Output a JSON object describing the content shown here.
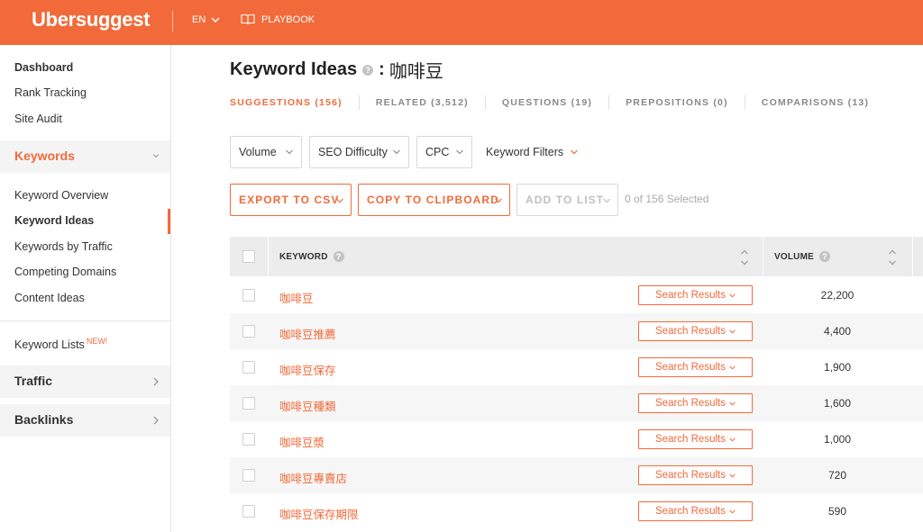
{
  "topbar": {
    "logo": "Ubersuggest",
    "language": "EN",
    "playbook": "PLAYBOOK"
  },
  "sidebar": {
    "top_links": [
      "Dashboard",
      "Rank Tracking",
      "Site Audit"
    ],
    "keywords_section": "Keywords",
    "keywords_items": [
      "Keyword Overview",
      "Keyword Ideas",
      "Keywords by Traffic",
      "Competing Domains",
      "Content Ideas"
    ],
    "keyword_lists": "Keyword Lists",
    "new_badge": "NEW!",
    "traffic_section": "Traffic",
    "backlinks_section": "Backlinks"
  },
  "main": {
    "title": "Keyword Ideas",
    "title_separator": ":",
    "keyword": "咖啡豆",
    "tabs": [
      {
        "label": "SUGGESTIONS (156)",
        "active": true
      },
      {
        "label": "RELATED (3,512)",
        "active": false
      },
      {
        "label": "QUESTIONS (19)",
        "active": false
      },
      {
        "label": "PREPOSITIONS (0)",
        "active": false
      },
      {
        "label": "COMPARISONS (13)",
        "active": false
      }
    ],
    "filters": {
      "volume": "Volume",
      "seo_difficulty": "SEO Difficulty",
      "cpc": "CPC",
      "keyword_filters": "Keyword Filters"
    },
    "actions": {
      "export": "EXPORT TO CSV",
      "copy": "COPY TO CLIPBOARD",
      "add_to_list": "ADD TO LIST",
      "selected": "0 of 156 Selected"
    },
    "table": {
      "col_keyword": "KEYWORD",
      "col_volume": "VOLUME",
      "search_results_label": "Search Results",
      "rows": [
        {
          "keyword": "咖啡豆",
          "volume": "22,200"
        },
        {
          "keyword": "咖啡豆推薦",
          "volume": "4,400"
        },
        {
          "keyword": "咖啡豆保存",
          "volume": "1,900"
        },
        {
          "keyword": "咖啡豆種類",
          "volume": "1,600"
        },
        {
          "keyword": "咖啡豆漿",
          "volume": "1,000"
        },
        {
          "keyword": "咖啡豆專賣店",
          "volume": "720"
        },
        {
          "keyword": "咖啡豆保存期限",
          "volume": "590"
        }
      ]
    }
  },
  "colors": {
    "brand": "#f26a3a",
    "header_bg": "#ececec",
    "row_alt": "#f6f6f6"
  }
}
